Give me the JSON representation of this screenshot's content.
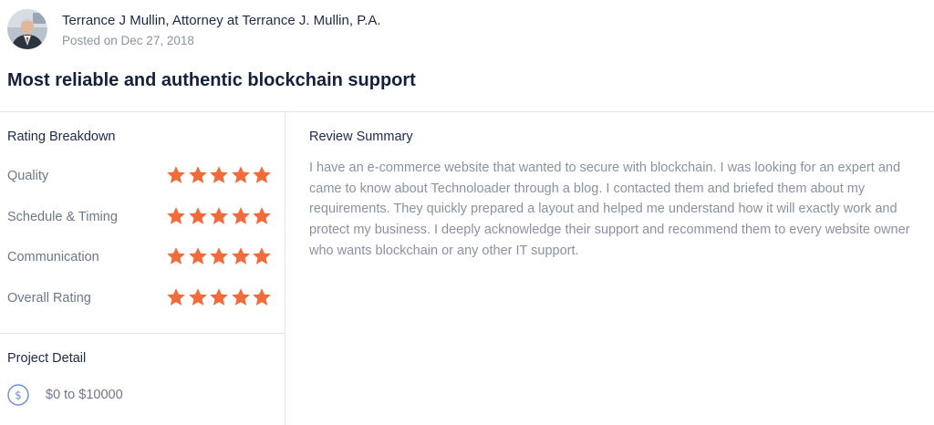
{
  "reviewer": {
    "name": "Terrance J Mullin, Attorney at Terrance J. Mullin, P.A.",
    "posted": "Posted on Dec 27, 2018",
    "avatar_icon": "person-portrait-icon"
  },
  "review": {
    "headline": "Most reliable and authentic blockchain support"
  },
  "rating_breakdown": {
    "title": "Rating Breakdown",
    "star_color": "#f26b3a",
    "items": [
      {
        "label": "Quality",
        "stars": 5
      },
      {
        "label": "Schedule & Timing",
        "stars": 5
      },
      {
        "label": "Communication",
        "stars": 5
      },
      {
        "label": "Overall Rating",
        "stars": 5
      }
    ]
  },
  "project_detail": {
    "title": "Project Detail",
    "budget_icon": "dollar-icon",
    "budget": "$0 to $10000"
  },
  "summary": {
    "title": "Review Summary",
    "text": "I have an e-commerce website that wanted to secure with blockchain. I was looking for an expert and came to know about Technoloader through a blog. I contacted them and briefed them about my requirements. They quickly prepared a layout and helped me understand how it will exactly work and protect my business. I deeply acknowledge their support and recommend them to every website owner who wants blockchain or any other IT support."
  }
}
